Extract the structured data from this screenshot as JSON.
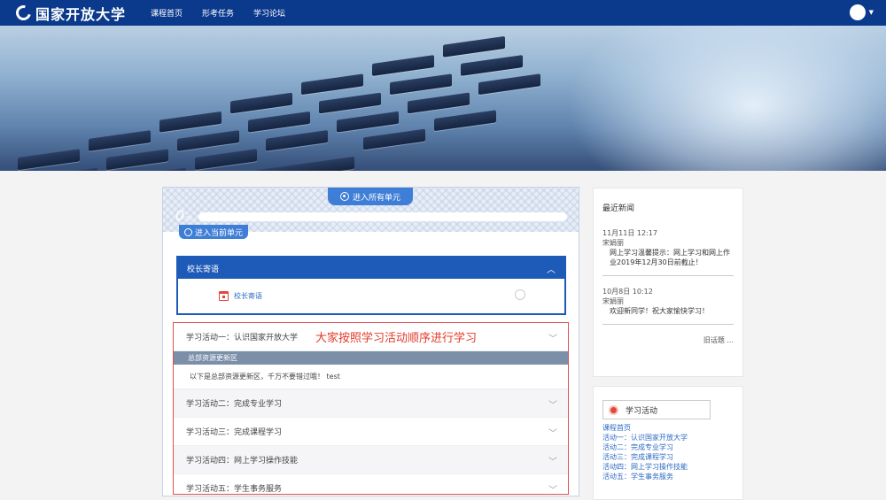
{
  "topbar": {
    "logo_text": "国家开放大学",
    "nav": [
      "课程首页",
      "形考任务",
      "学习论坛"
    ]
  },
  "main": {
    "all_units_label": "进入所有单元",
    "progress_value": "0",
    "progress_unit": "%",
    "progress_fraction": 0,
    "current_unit_label": "进入当前单元",
    "section_title": "校长寄语",
    "section_item": "校长寄语",
    "activities": [
      "学习活动一：认识国家开放大学",
      "学习活动二：完成专业学习",
      "学习活动三：完成课程学习",
      "学习活动四：网上学习操作技能",
      "学习活动五：学生事务服务"
    ],
    "hint": "大家按照学习活动顺序进行学习",
    "sub_header": "总部资源更新区",
    "sub_text": "以下是总部资源更新区，千万不要错过哦！ test"
  },
  "news": {
    "title": "最近新闻",
    "items": [
      {
        "date": "11月11日 12:17",
        "author": "宋娟丽",
        "body": "网上学习温馨提示：网上学习和网上作业2019年12月30日前截止！"
      },
      {
        "date": "10月8日 10:12",
        "author": "宋娟丽",
        "body": "欢迎新同学！祝大家愉快学习！"
      }
    ],
    "more": "旧话题 ..."
  },
  "sidebar_activity": {
    "title": "学习活动",
    "links": [
      "课程首页",
      "活动一：认识国家开放大学",
      "活动二：完成专业学习",
      "活动三：完成课程学习",
      "活动四：网上学习操作技能",
      "活动五：学生事务服务"
    ]
  },
  "colors": {
    "nav_bg": "#0b3a8c",
    "accent_blue": "#1e5bb8",
    "hint_red": "#e23a2a"
  }
}
